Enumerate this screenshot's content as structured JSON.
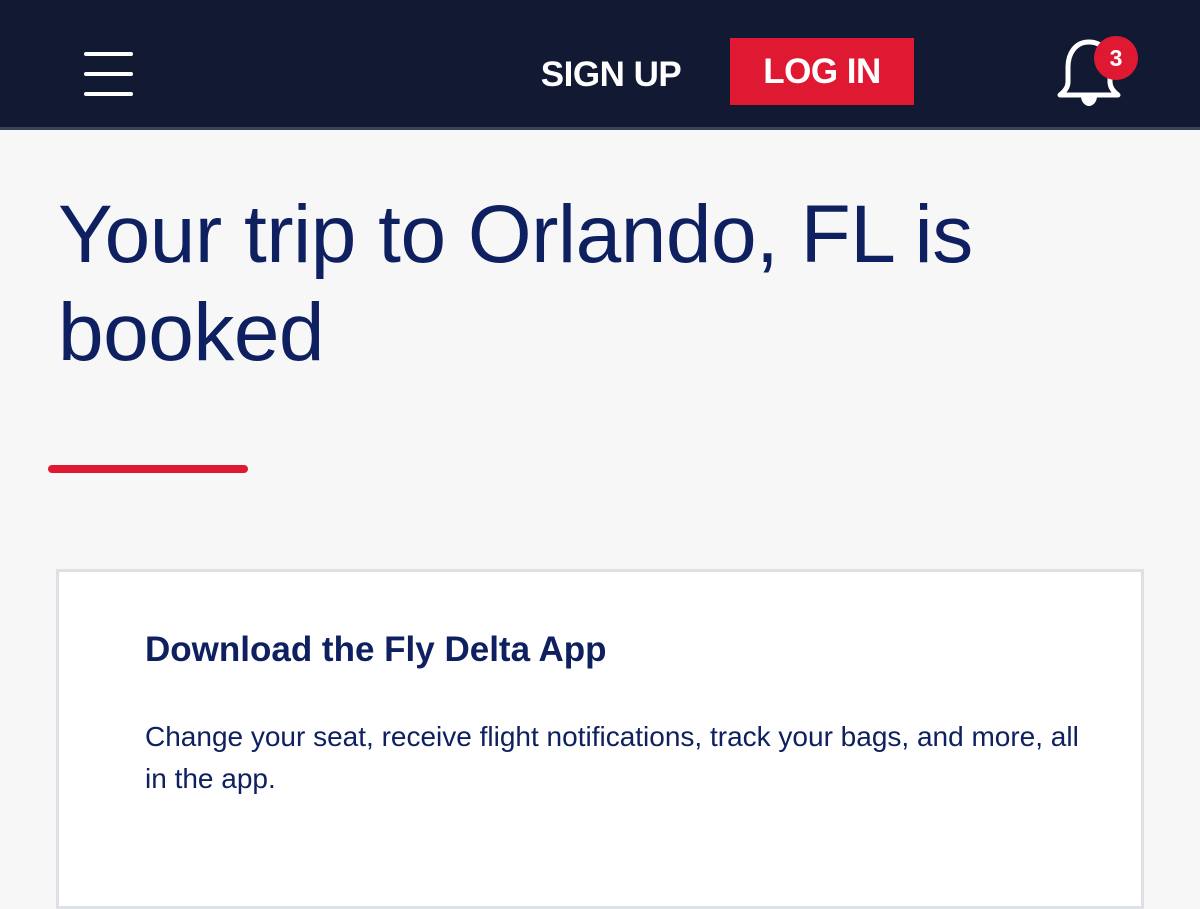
{
  "header": {
    "signup_label": "SIGN UP",
    "login_label": "LOG IN",
    "notification_count": "3",
    "colors": {
      "bar_background": "#111a32",
      "accent_red": "#e01933"
    },
    "icons": {
      "menu": "hamburger-menu-icon",
      "notifications": "bell-icon"
    }
  },
  "main": {
    "headline": "Your trip to Orlando, FL is booked",
    "heading_color": "#0f2060"
  },
  "app_card": {
    "title": "Download the Fly Delta App",
    "description": "Change your seat, receive flight notifications, track your bags, and more, all in the app."
  }
}
